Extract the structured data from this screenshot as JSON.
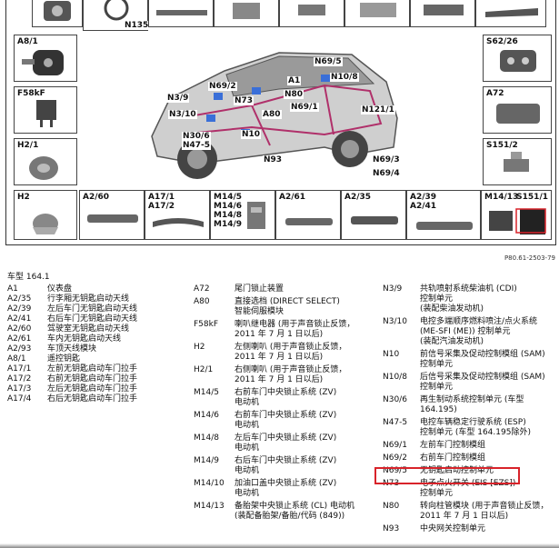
{
  "diagram": {
    "figure_ref": "P80.61-2503-79",
    "boxes": {
      "a8_1": "A8/1",
      "f58kf": "F58kF",
      "h2_1": "H2/1",
      "h2": "H2",
      "a2_60": "A2/60",
      "a17_1_2": "A17/1\nA17/2",
      "m14": "M14/5\nM14/6\nM14/8\nM14/9",
      "a2_61": "A2/61",
      "a2_35": "A2/35",
      "a2_39_41": "A2/39\nA2/41",
      "m14_13": "M14/13",
      "s151_1": "S151/1",
      "s62_26": "S62/26",
      "a72": "A72",
      "s151_2": "S151/2"
    },
    "callouts": {
      "n135": "N135",
      "n69_5": "N69/5",
      "a1": "A1",
      "n69_2": "N69/2",
      "n3_9": "N3/9",
      "n73": "N73",
      "n80": "N80",
      "n10_8": "N10/8",
      "a80": "A80",
      "n69_1": "N69/1",
      "n3_10": "N3/10",
      "n121_1": "N121/1",
      "n30_6": "N30/6",
      "n47_5": "N47-5",
      "n10": "N10",
      "n93": "N93",
      "n69_3": "N69/3",
      "n69_4": "N69/4"
    }
  },
  "legend": {
    "vehicle": "车型 164.1",
    "col1": [
      {
        "code": "A1",
        "desc": "仪表盘"
      },
      {
        "code": "A2/35",
        "desc": "行李厢无钥匙启动天线"
      },
      {
        "code": "A2/39",
        "desc": "左后车门无钥匙启动天线"
      },
      {
        "code": "A2/41",
        "desc": "右后车门无钥匙启动天线"
      },
      {
        "code": "A2/60",
        "desc": "驾驶室无钥匙启动天线"
      },
      {
        "code": "A2/61",
        "desc": "车内无钥匙启动天线"
      },
      {
        "code": "A2/93",
        "desc": "车顶天线模块"
      },
      {
        "code": "A8/1",
        "desc": "遥控钥匙"
      },
      {
        "code": "A17/1",
        "desc": "左前无钥匙启动车门拉手"
      },
      {
        "code": "A17/2",
        "desc": "右前无钥匙启动车门拉手"
      },
      {
        "code": "A17/3",
        "desc": "左后无钥匙启动车门拉手"
      },
      {
        "code": "A17/4",
        "desc": "右后无钥匙启动车门拉手"
      }
    ],
    "col2": [
      {
        "code": "A72",
        "desc": "尾门锁止装置"
      },
      {
        "code": "A80",
        "desc": "直接选档 (DIRECT SELECT)\n智能伺服模块"
      },
      {
        "code": "F58kF",
        "desc": "喇叭继电器 (用于声音锁止反馈，\n2011 年 7 月 1 日以后)"
      },
      {
        "code": "H2",
        "desc": "左侧喇叭 (用于声音锁止反馈，\n2011 年 7 月 1 日以后)"
      },
      {
        "code": "H2/1",
        "desc": "右侧喇叭 (用于声音锁止反馈，\n2011 年 7 月 1 日以后)"
      },
      {
        "code": "M14/5",
        "desc": "右前车门中央锁止系统 (ZV)\n电动机"
      },
      {
        "code": "M14/6",
        "desc": "右前车门中央锁止系统 (ZV)\n电动机"
      },
      {
        "code": "M14/8",
        "desc": "左后车门中央锁止系统 (ZV)\n电动机"
      },
      {
        "code": "M14/9",
        "desc": "右后车门中央锁止系统 (ZV)\n电动机"
      },
      {
        "code": "M14/10",
        "desc": "加油口盖中央锁止系统 (ZV)\n电动机"
      },
      {
        "code": "M14/13",
        "desc": "备胎架中央锁止系统 (CL) 电动机\n(装配备胎架/备胎/代码 (849))"
      }
    ],
    "col3": [
      {
        "code": "N3/9",
        "desc": "共轨喷射系统柴油机 (CDI)\n控制单元\n(装配柴油发动机)"
      },
      {
        "code": "N3/10",
        "desc": "电控多端顺序燃料喷注/点火系统\n(ME-SFI (ME)) 控制单元\n(装配汽油发动机)"
      },
      {
        "code": "N10",
        "desc": "前信号采集及促动控制模组 (SAM)\n控制单元"
      },
      {
        "code": "N10/8",
        "desc": "后信号采集及促动控制模组 (SAM)\n控制单元"
      },
      {
        "code": "N30/6",
        "desc": "再生制动系统控制单元 (车型\n164.195)"
      },
      {
        "code": "N47-5",
        "desc": "电控车辆稳定行驶系统 (ESP)\n控制单元 (车型 164.195除外)"
      },
      {
        "code": "N69/1",
        "desc": "左前车门控制模组"
      },
      {
        "code": "N69/2",
        "desc": "右前车门控制模组"
      },
      {
        "code": "N69/5",
        "desc": "无钥匙启动控制单元"
      },
      {
        "code": "N73",
        "desc": "电子点火开关 (EIS [EZS])\n控制单元"
      },
      {
        "code": "N80",
        "desc": "转向柱管模块 (用于声音锁止反馈，\n2011 年 7 月 1 日以后)"
      },
      {
        "code": "N93",
        "desc": "中央网关控制单元"
      }
    ]
  },
  "colors": {
    "highlight": "#d8232a",
    "wire": "#b0306a",
    "module": "#3a6fd8"
  }
}
